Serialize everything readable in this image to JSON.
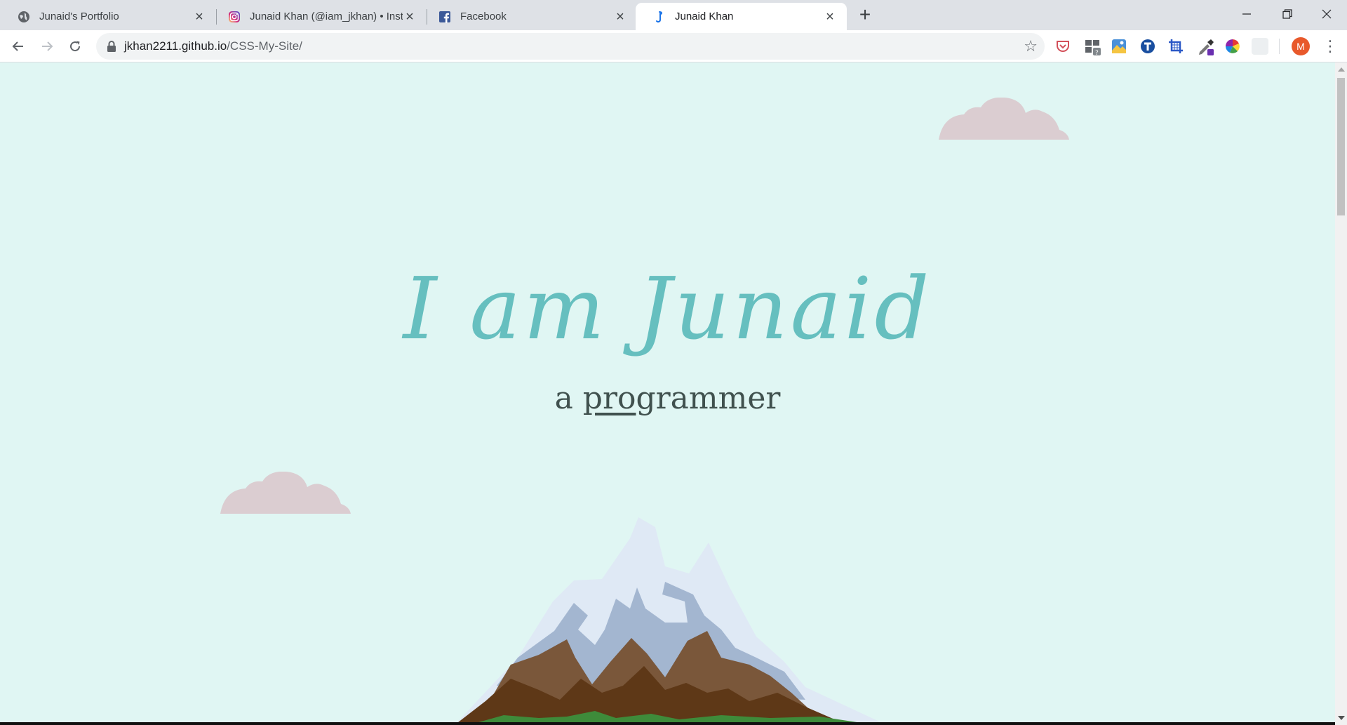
{
  "browser": {
    "tabs": [
      {
        "title": "Junaid's Portfolio",
        "favicon": "globe-icon",
        "active": false
      },
      {
        "title": "Junaid Khan (@iam_jkhan) • Insta",
        "favicon": "instagram-icon",
        "active": false
      },
      {
        "title": "Facebook",
        "favicon": "facebook-icon",
        "active": false
      },
      {
        "title": "Junaid Khan",
        "favicon": "site-icon",
        "active": true
      }
    ],
    "address": {
      "host": "jkhan2211.github.io",
      "path": "/CSS-My-Site/"
    },
    "profile_initial": "M",
    "extensions": [
      "pocket-icon",
      "extension-puzzle-icon",
      "image-icon",
      "t-circle-icon",
      "crop-icon",
      "eyedropper-icon",
      "color-wheel-icon",
      "blank-extension-icon"
    ]
  },
  "page": {
    "heading": "I am Junaid",
    "subtitle_prefix": "a ",
    "subtitle_underlined": "pro",
    "subtitle_rest": "grammer"
  },
  "colors": {
    "background": "#e0f6f3",
    "heading": "#66bfbf",
    "subtitle": "#40514e",
    "cloud": "#dbcdd1",
    "snow": "#dfe9f5",
    "snow_shadow": "#a3b6d0",
    "rock_light": "#7a573a",
    "rock_dark": "#5e3817",
    "grass": "#3e8b3a"
  }
}
